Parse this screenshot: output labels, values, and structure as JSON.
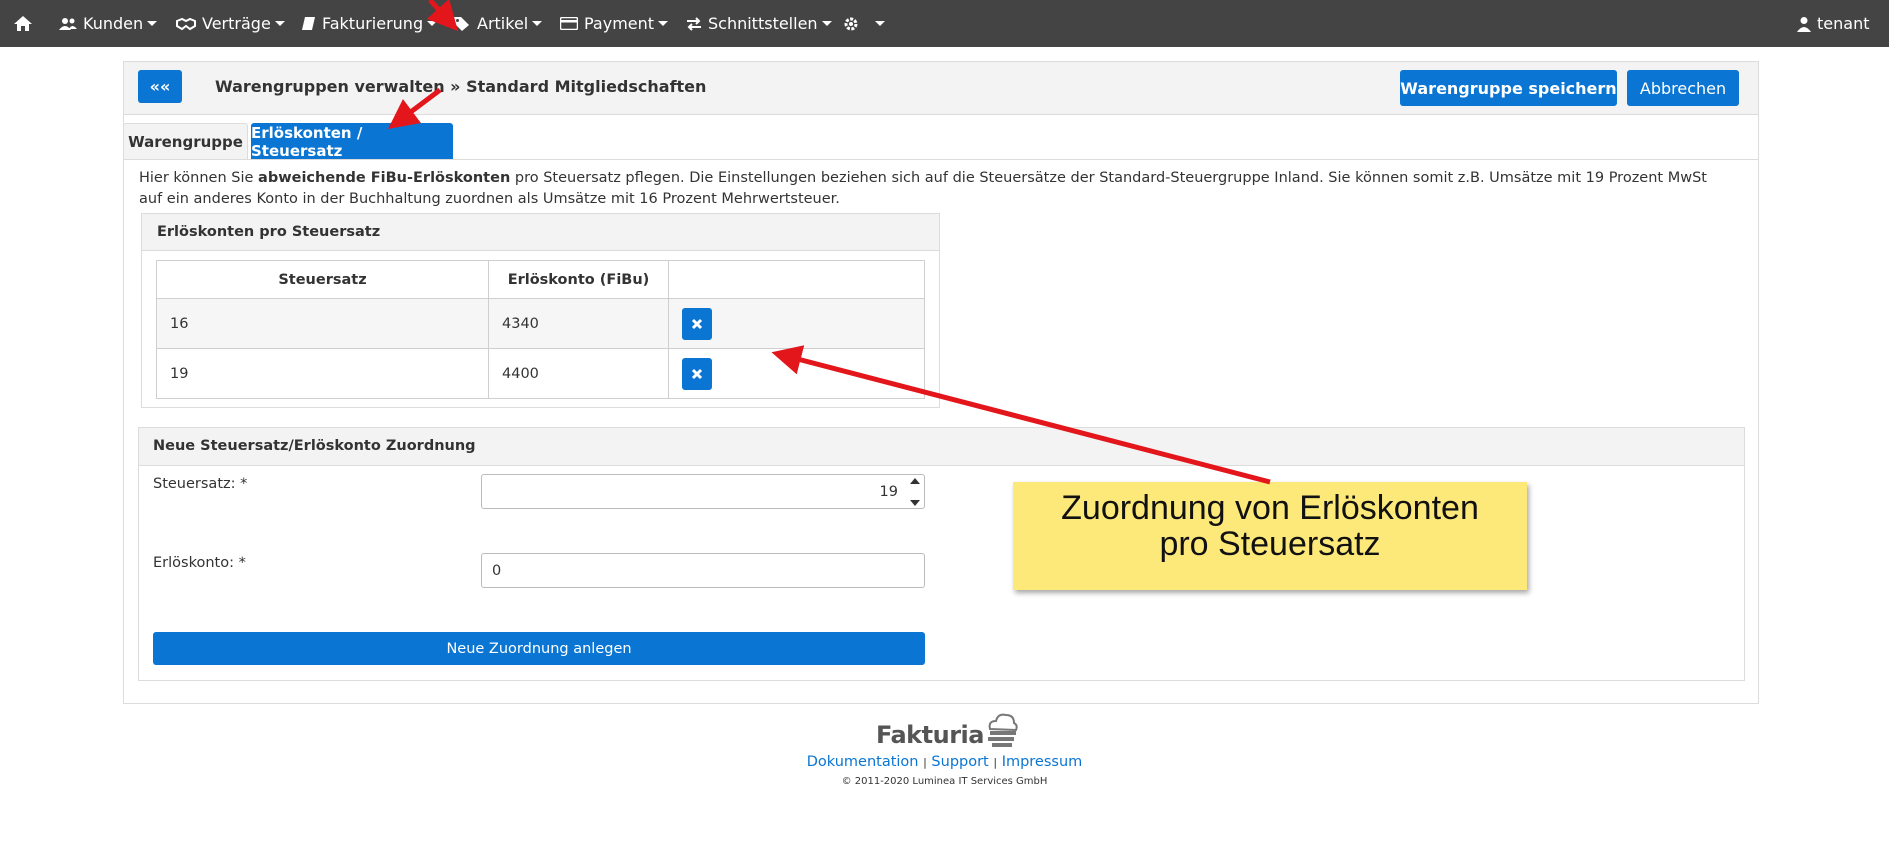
{
  "nav": {
    "home_icon": "home-icon",
    "items": [
      {
        "label": "Kunden",
        "icon": "users-icon"
      },
      {
        "label": "Verträge",
        "icon": "handshake-icon"
      },
      {
        "label": "Fakturierung",
        "icon": "book-icon"
      },
      {
        "label": "Artikel",
        "icon": "tags-icon"
      },
      {
        "label": "Payment",
        "icon": "credit-card-icon"
      },
      {
        "label": "Schnittstellen",
        "icon": "exchange-icon"
      }
    ],
    "settings_icon": "gear-icon",
    "user": "tenant"
  },
  "header": {
    "back_label": "««",
    "title": "Warengruppen verwalten » Standard Mitgliedschaften",
    "save_label": "Warengruppe speichern",
    "cancel_label": "Abbrechen"
  },
  "tabs": [
    {
      "label": "Warengruppe",
      "active": false
    },
    {
      "label": "Erlöskonten / Steuersatz",
      "active": true
    }
  ],
  "intro": {
    "pre": "Hier können Sie ",
    "bold": "abweichende FiBu-Erlöskonten",
    "post": " pro Steuersatz pflegen. Die Einstellungen beziehen sich auf die Steuersätze der Standard-Steuergruppe Inland. Sie können somit z.B. Umsätze mit 19 Prozent MwSt auf ein anderes Konto in der Buchhaltung zuordnen als Umsätze mit 16 Prozent Mehrwertsteuer."
  },
  "accounts_panel": {
    "title": "Erlöskonten pro Steuersatz",
    "columns": [
      "Steuersatz",
      "Erlöskonto (FiBu)",
      ""
    ],
    "rows": [
      {
        "rate": "16",
        "account": "4340"
      },
      {
        "rate": "19",
        "account": "4400"
      }
    ]
  },
  "new_panel": {
    "title": "Neue Steuersatz/Erlöskonto Zuordnung",
    "rate_label": "Steuersatz: *",
    "rate_value": "19",
    "account_label": "Erlöskonto: *",
    "account_value": "0",
    "submit_label": "Neue Zuordnung anlegen"
  },
  "footer": {
    "logo_text": "Fakturia",
    "links": [
      "Dokumentation",
      "Support",
      "Impressum"
    ],
    "separator": "|",
    "copyright": "© 2011-2020 Luminea IT Services GmbH"
  },
  "annotation": {
    "line1": "Zuordnung von Erlöskonten",
    "line2": "pro Steuersatz"
  },
  "colors": {
    "primary": "#0a75d2",
    "navbar": "#444444",
    "callout": "#fde97a",
    "arrow": "#e3161c"
  }
}
